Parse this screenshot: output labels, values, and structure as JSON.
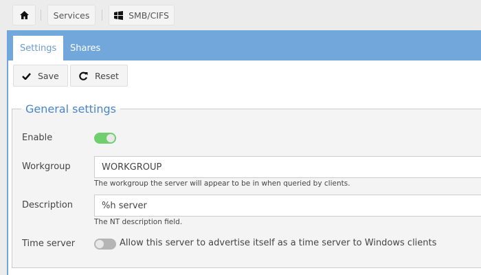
{
  "breadcrumb": {
    "home_icon": "home-icon",
    "services": "Services",
    "smb_icon": "windows-icon",
    "smb": "SMB/CIFS"
  },
  "tabs": [
    {
      "label": "Settings",
      "active": true
    },
    {
      "label": "Shares",
      "active": false
    }
  ],
  "toolbar": {
    "save_label": "Save",
    "reset_label": "Reset"
  },
  "general": {
    "legend": "General settings",
    "enable_label": "Enable",
    "enable_value": true,
    "workgroup_label": "Workgroup",
    "workgroup_value": "WORKGROUP",
    "workgroup_help": "The workgroup the server will appear to be in when queried by clients.",
    "description_label": "Description",
    "description_value": "%h server",
    "description_help": "The NT description field.",
    "timeserver_label": "Time server",
    "timeserver_value": false,
    "timeserver_text": "Allow this server to advertise itself as a time server to Windows clients"
  },
  "colors": {
    "accent": "#72a7db",
    "toggle_on": "#6fcf6f",
    "toggle_off": "#b5b5b5"
  }
}
